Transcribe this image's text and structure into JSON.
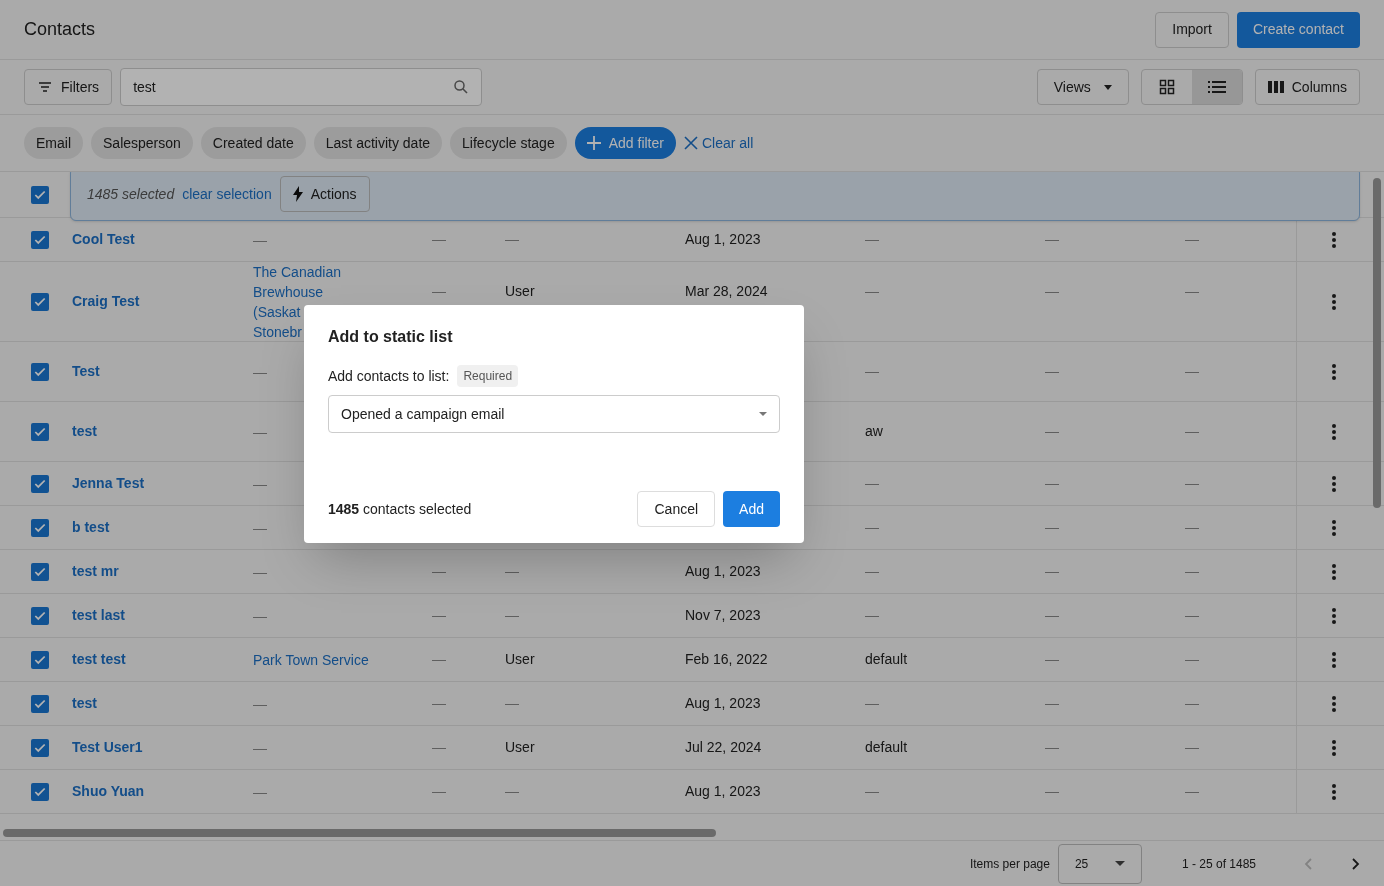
{
  "header": {
    "title": "Contacts",
    "import_button": "Import",
    "create_button": "Create contact"
  },
  "toolbar": {
    "filters_button": "Filters",
    "search": {
      "value": "test"
    },
    "views_button": "Views",
    "view_toggle": [
      {
        "kind": "grid",
        "selected": false
      },
      {
        "kind": "list",
        "selected": true
      }
    ],
    "columns_button": "Columns"
  },
  "filter_chips": [
    "Email",
    "Salesperson",
    "Created date",
    "Last activity date",
    "Lifecycle stage"
  ],
  "add_filter": "Add filter",
  "clear_all": "Clear all",
  "selection_bar": {
    "all_checked": true,
    "count": "1485 selected",
    "clear": "clear selection",
    "actions": "Actions"
  },
  "rows": [
    {
      "name": "Cool Test",
      "checked": true,
      "column_2": [
        "—"
      ],
      "column_3": "—",
      "column_4": "—",
      "column_5": "Aug 1, 2023",
      "column_6": "—",
      "column_7": "—",
      "column_8": "—"
    },
    {
      "name": "Craig Test",
      "checked": true,
      "column_2": [
        "The Canadian",
        "Brewhouse",
        "(Saskat",
        "Stonebr"
      ],
      "column_3": "—",
      "column_4": "User",
      "column_5": "Mar 28, 2024",
      "column_6": "—",
      "column_7": "—",
      "column_8": "—"
    },
    {
      "name": "Test",
      "checked": true,
      "column_2": [
        "—"
      ],
      "column_6": "—",
      "column_7": "—",
      "column_8": "—"
    },
    {
      "name": "test",
      "checked": true,
      "column_2": [
        "—"
      ],
      "column_6": "aw",
      "column_7": "—",
      "column_8": "—"
    },
    {
      "name": "Jenna Test",
      "checked": true,
      "column_2": [
        "—"
      ],
      "column_6": "—",
      "column_7": "—",
      "column_8": "—"
    },
    {
      "name": "b test",
      "checked": true,
      "column_2": [
        "—"
      ],
      "column_6": "—",
      "column_7": "—",
      "column_8": "—"
    },
    {
      "name": "test mr",
      "checked": true,
      "column_2": [
        "—"
      ],
      "column_3": "—",
      "column_4": "—",
      "column_5": "Aug 1, 2023",
      "column_6": "—",
      "column_7": "—",
      "column_8": "—"
    },
    {
      "name": "test last",
      "checked": true,
      "column_2": [
        "—"
      ],
      "column_3": "—",
      "column_4": "—",
      "column_5": "Nov 7, 2023",
      "column_6": "—",
      "column_7": "—",
      "column_8": "—"
    },
    {
      "name": "test test",
      "checked": true,
      "column_2": [
        "Park Town Service"
      ],
      "column_3": "—",
      "column_4": "User",
      "column_5": "Feb 16, 2022",
      "column_6": "default",
      "column_7": "—",
      "column_8": "—"
    },
    {
      "name": "test",
      "checked": true,
      "column_2": [
        "—"
      ],
      "column_3": "—",
      "column_4": "—",
      "column_5": "Aug 1, 2023",
      "column_6": "—",
      "column_7": "—",
      "column_8": "—"
    },
    {
      "name": "Test User1",
      "checked": true,
      "column_2": [
        "—"
      ],
      "column_3": "—",
      "column_4": "User",
      "column_5": "Jul 22, 2024",
      "column_6": "default",
      "column_7": "—",
      "column_8": "—"
    },
    {
      "name": "Shuo Yuan",
      "checked": true,
      "column_2": [
        "—"
      ],
      "column_3": "—",
      "column_4": "—",
      "column_5": "Aug 1, 2023",
      "column_6": "—",
      "column_7": "—",
      "column_8": "—"
    }
  ],
  "pagination": {
    "items_per_page_label": "Items per page",
    "items_per_page": "25",
    "range": "1 - 25 of 1485"
  },
  "dialog": {
    "title": "Add to static list",
    "field_label": "Add contacts to list:",
    "required_badge": "Required",
    "list_value": "Opened a campaign email",
    "summary": "**1485** contacts selected",
    "cancel": "Cancel",
    "add": "Add"
  }
}
